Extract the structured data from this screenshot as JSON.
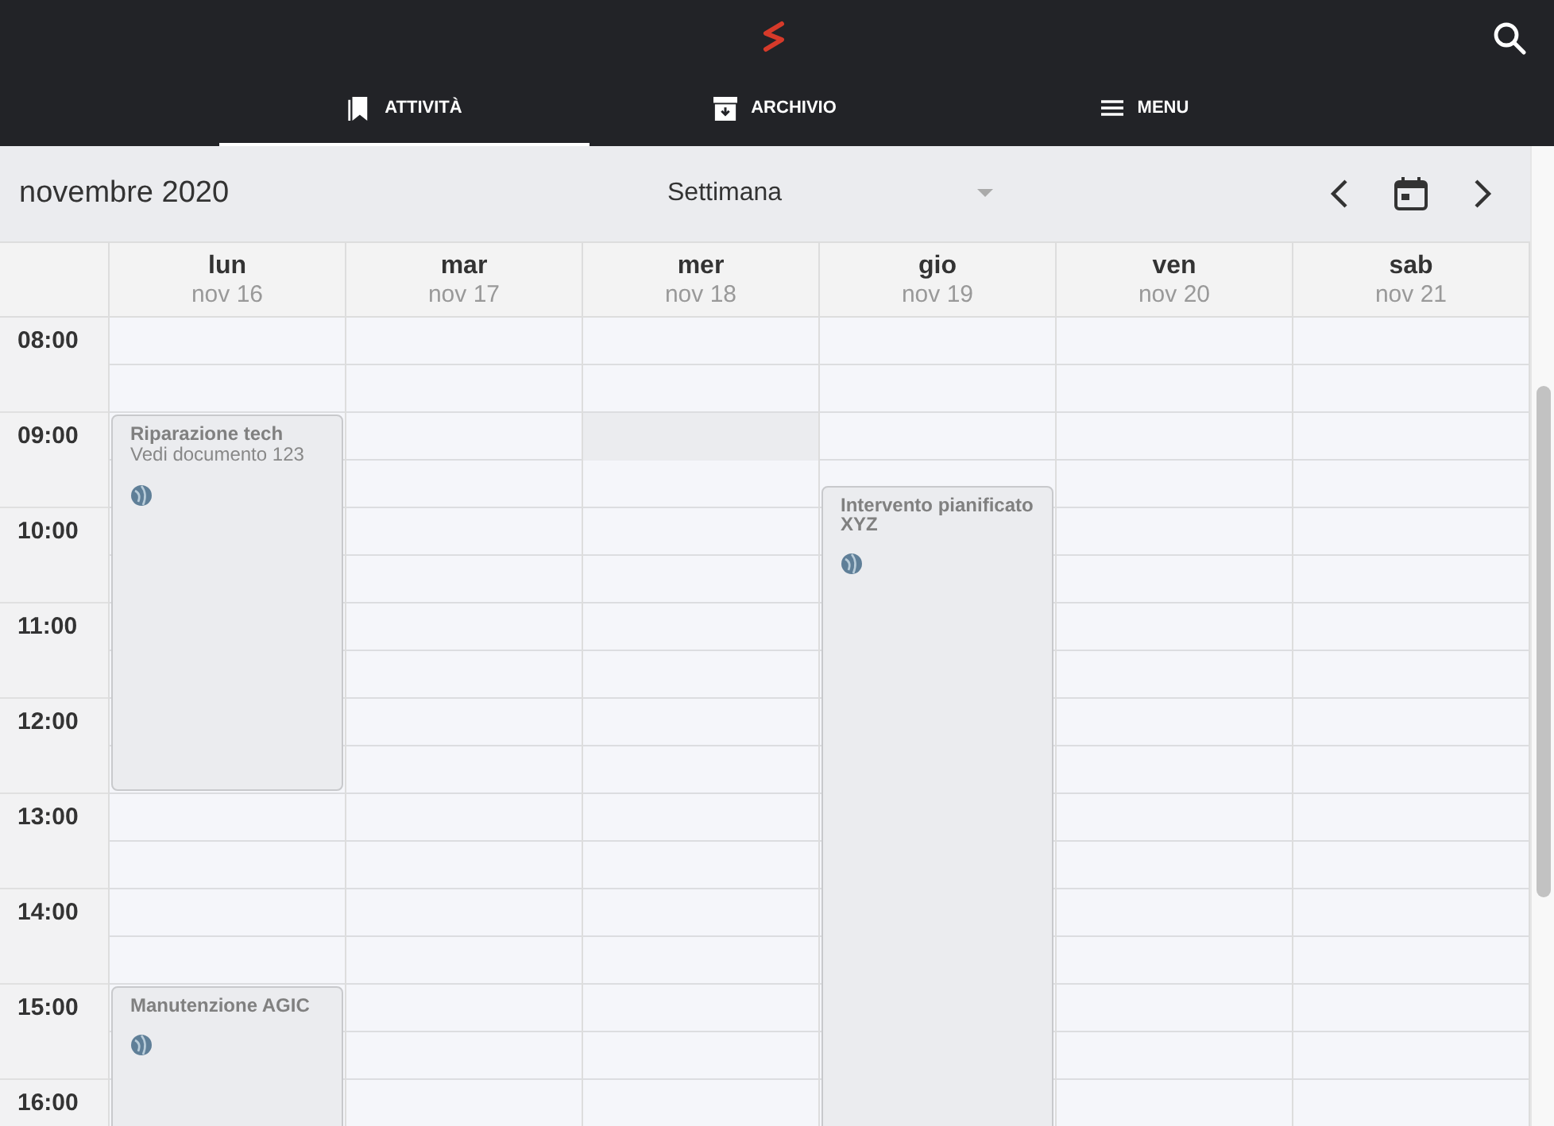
{
  "header": {
    "tabs": [
      {
        "label": "ATTIVITÀ",
        "selected": true
      },
      {
        "label": "ARCHIVIO",
        "selected": false
      },
      {
        "label": "MENU",
        "selected": false
      }
    ]
  },
  "toolbar": {
    "month": "novembre 2020",
    "view": "Settimana"
  },
  "calendar": {
    "hours": [
      "08:00",
      "09:00",
      "10:00",
      "11:00",
      "12:00",
      "13:00",
      "14:00",
      "15:00",
      "16:00"
    ],
    "days": [
      {
        "name": "lun",
        "date": "nov 16",
        "highlight": false,
        "events": [
          {
            "title": "Riparazione tech",
            "subtitle": "Vedi documento 123"
          },
          {
            "title": "Manutenzione AGIC"
          }
        ]
      },
      {
        "name": "mar",
        "date": "nov 17",
        "highlight": false
      },
      {
        "name": "mer",
        "date": "nov 18",
        "highlight": true
      },
      {
        "name": "gio",
        "date": "nov 19",
        "highlight": false,
        "events": [
          {
            "title": "Intervento pianificato XYZ"
          }
        ]
      },
      {
        "name": "ven",
        "date": "nov 20",
        "highlight": false
      },
      {
        "name": "sab",
        "date": "nov 21",
        "highlight": false
      }
    ]
  }
}
